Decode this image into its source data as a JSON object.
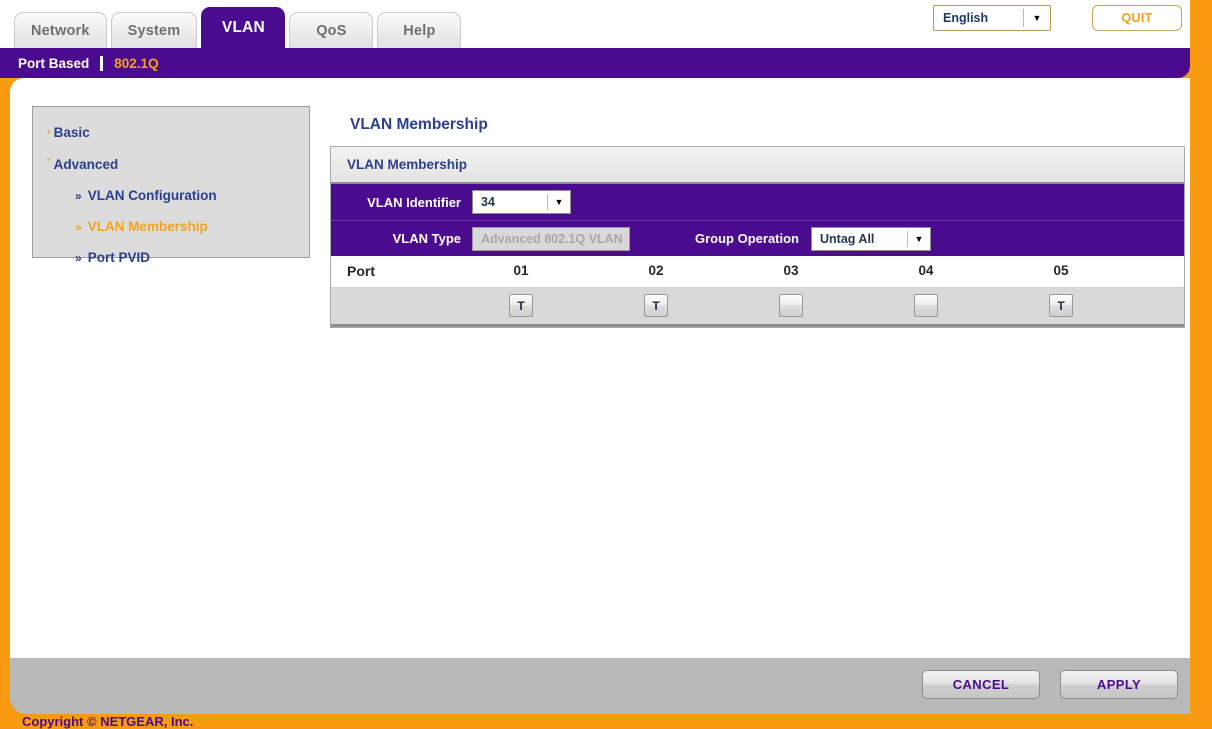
{
  "header": {
    "tabs": [
      {
        "label": "Network",
        "active": false
      },
      {
        "label": "System",
        "active": false
      },
      {
        "label": "VLAN",
        "active": true
      },
      {
        "label": "QoS",
        "active": false
      },
      {
        "label": "Help",
        "active": false
      }
    ],
    "language": {
      "value": "English",
      "arrow": "▼"
    },
    "quit_label": "QUIT"
  },
  "subnav": {
    "items": [
      {
        "label": "Port Based",
        "selected": false
      },
      {
        "label": "802.1Q",
        "selected": true
      }
    ]
  },
  "sidebar": {
    "groups": [
      {
        "label": "Basic",
        "caret": "›",
        "selected": false
      },
      {
        "label": "Advanced",
        "caret": "ˇ",
        "selected": false
      }
    ],
    "sub_items": [
      {
        "label": "VLAN Configuration",
        "chevron": "»",
        "selected": false
      },
      {
        "label": "VLAN Membership",
        "chevron": "»",
        "selected": true
      },
      {
        "label": "Port PVID",
        "chevron": "»",
        "selected": false
      }
    ]
  },
  "main": {
    "page_title": "VLAN Membership",
    "panel_header": "VLAN Membership",
    "vlan_identifier": {
      "label": "VLAN Identifier",
      "value": "34",
      "arrow": "▼"
    },
    "vlan_type": {
      "label": "VLAN Type",
      "value": "Advanced 802.1Q VLAN",
      "readonly": true
    },
    "group_operation": {
      "label": "Group Operation",
      "value": "Untag All",
      "arrow": "▼"
    },
    "port_table": {
      "row_label": "Port",
      "ports": [
        "01",
        "02",
        "03",
        "04",
        "05"
      ],
      "states": [
        "T",
        "T",
        "",
        "",
        "T"
      ]
    }
  },
  "footer": {
    "cancel_label": "CANCEL",
    "apply_label": "APPLY",
    "copyright": "Copyright © NETGEAR, Inc."
  },
  "colors": {
    "brand_orange": "#f99b10",
    "brand_purple": "#4b0b8f",
    "nav_blue": "#2b3f8c",
    "accent_orange": "#f5a21c"
  }
}
